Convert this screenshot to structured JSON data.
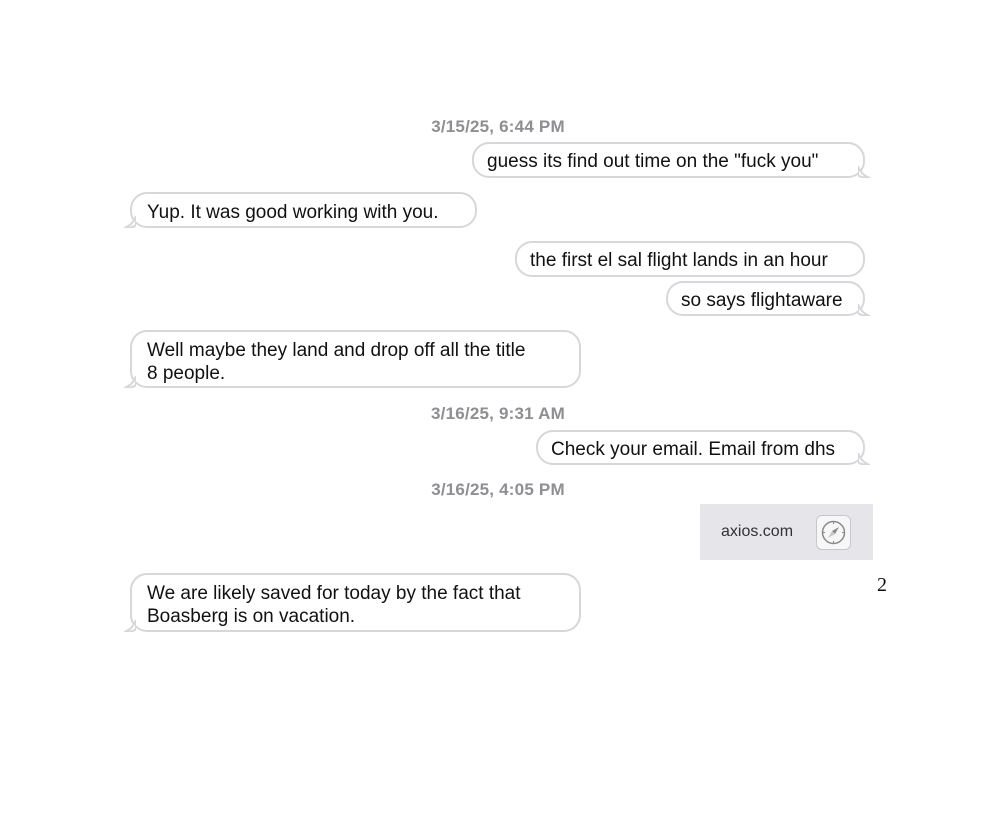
{
  "messages": [
    {
      "type": "timestamp",
      "text": "3/15/25, 6:44 PM"
    },
    {
      "type": "outgoing",
      "text": "guess its find out time on the \"fuck you\""
    },
    {
      "type": "incoming",
      "text": "Yup.  It was good working with you."
    },
    {
      "type": "outgoing",
      "text": "the first el sal flight lands in an hour"
    },
    {
      "type": "outgoing",
      "text": "so says flightaware"
    },
    {
      "type": "incoming",
      "text": "Well maybe they land and drop off all the title\n8 people."
    },
    {
      "type": "timestamp",
      "text": "3/16/25, 9:31 AM"
    },
    {
      "type": "outgoing",
      "text": "Check your email. Email from dhs"
    },
    {
      "type": "timestamp",
      "text": "3/16/25, 4:05 PM"
    },
    {
      "type": "link_preview",
      "domain": "axios.com",
      "icon": "compass-icon"
    },
    {
      "type": "incoming",
      "text": "We are likely saved for today by the fact that\nBoasberg is on vacation."
    }
  ],
  "page_number": "2",
  "colors": {
    "timestamp": "#8e8e93",
    "bubble_border": "#d7d7db",
    "link_card_bg": "#e5e5ea",
    "text": "#111111"
  }
}
